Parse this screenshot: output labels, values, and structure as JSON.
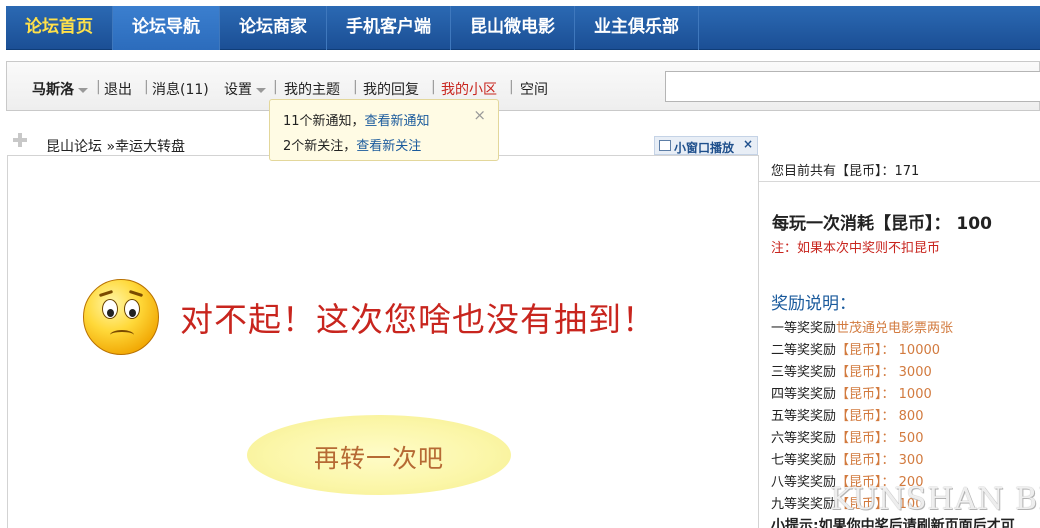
{
  "topnav": [
    {
      "label": "论坛首页",
      "state": "home"
    },
    {
      "label": "论坛导航",
      "state": "active"
    },
    {
      "label": "论坛商家",
      "state": ""
    },
    {
      "label": "手机客户端",
      "state": ""
    },
    {
      "label": "昆山微电影",
      "state": ""
    },
    {
      "label": "业主俱乐部",
      "state": ""
    }
  ],
  "userbar": {
    "username": "马斯洛",
    "logout": "退出",
    "messages": "消息(11)",
    "settings": "设置",
    "my_topics": "我的主题",
    "my_replies": "我的回复",
    "my_community": "我的小区",
    "space": "空间",
    "separator": "|"
  },
  "popup": {
    "line1_text": "11个新通知，",
    "line1_link": "查看新通知",
    "line2_text": "2个新关注，",
    "line2_link": "查看新关注",
    "close": "×"
  },
  "breadcrumb": "昆山论坛 »幸运大转盘",
  "mini_player": {
    "label": "小窗口播放",
    "close": "×"
  },
  "main": {
    "message": "对不起！这次您啥也没有抽到！",
    "retry": "再转一次吧"
  },
  "sidebar": {
    "balance": "您目前共有【昆币】：171",
    "cost": "每玩一次消耗【昆币】： 100",
    "note": "注：如果本次中奖则不扣昆币",
    "rewards_title": "奖励说明：",
    "prizes": [
      {
        "rank": "一等奖奖励",
        "reward": "世茂通兑电影票两张"
      },
      {
        "rank": "二等奖奖励",
        "reward": "【昆币】： 10000"
      },
      {
        "rank": "三等奖奖励",
        "reward": "【昆币】： 3000"
      },
      {
        "rank": "四等奖奖励",
        "reward": "【昆币】： 1000"
      },
      {
        "rank": "五等奖奖励",
        "reward": "【昆币】： 800"
      },
      {
        "rank": "六等奖奖励",
        "reward": "【昆币】： 500"
      },
      {
        "rank": "七等奖奖励",
        "reward": "【昆币】： 300"
      },
      {
        "rank": "八等奖奖励",
        "reward": "【昆币】： 200"
      },
      {
        "rank": "九等奖奖励",
        "reward": "【昆币】： 100"
      }
    ],
    "tip": "小提示:如果你中奖后请刷新页面后才可"
  },
  "watermark": "KUNSHAN BBS",
  "colors": {
    "nav_bg": "#1b4f95",
    "home_yellow": "#ffe14a",
    "alert_red": "#c8251e",
    "link_blue": "#1a5a9c",
    "reward_orange": "#d27a3e"
  }
}
